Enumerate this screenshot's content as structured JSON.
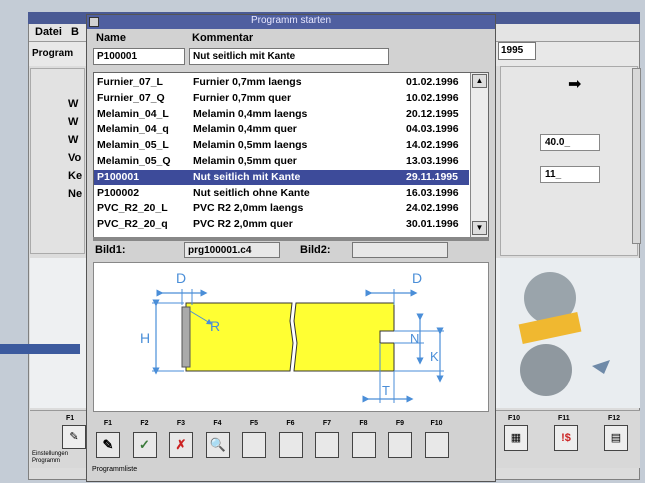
{
  "main": {
    "menu": [
      "Datei",
      "B"
    ],
    "program_label": "Program",
    "date_value": "1995",
    "left_buttons": [
      "W",
      "W",
      "W",
      "Vo",
      "Ke",
      "Ne"
    ],
    "right_inputs": [
      "40.0_",
      "11_"
    ],
    "f_labels": {
      "f1": "F1",
      "f10": "F10",
      "f11": "F11",
      "f12": "F12"
    },
    "bottom_left": "Einstellungen Programm"
  },
  "dialog": {
    "title": "Programm starten",
    "col_name": "Name",
    "col_comment": "Kommentar",
    "name_value": "P100001",
    "comment_value": "Nut seitlich mit Kante",
    "rows": [
      {
        "name": "Furnier_07_L",
        "comment": "Furnier 0,7mm laengs",
        "date": "01.02.1996"
      },
      {
        "name": "Furnier_07_Q",
        "comment": "Furnier 0,7mm quer",
        "date": "10.02.1996"
      },
      {
        "name": "Melamin_04_L",
        "comment": "Melamin 0,4mm laengs",
        "date": "20.12.1995"
      },
      {
        "name": "Melamin_04_q",
        "comment": "Melamin 0,4mm quer",
        "date": "04.03.1996"
      },
      {
        "name": "Melamin_05_L",
        "comment": "Melamin 0,5mm laengs",
        "date": "14.02.1996"
      },
      {
        "name": "Melamin_05_Q",
        "comment": "Melamin 0,5mm quer",
        "date": "13.03.1996"
      },
      {
        "name": "P100001",
        "comment": "Nut seitlich mit Kante",
        "date": "29.11.1995",
        "selected": true
      },
      {
        "name": "P100002",
        "comment": "Nut seitlich ohne Kante",
        "date": "16.03.1996"
      },
      {
        "name": "PVC_R2_20_L",
        "comment": "PVC R2 2,0mm laengs",
        "date": "24.02.1996"
      },
      {
        "name": "PVC_R2_20_q",
        "comment": "PVC R2 2,0mm quer",
        "date": "30.01.1996"
      }
    ],
    "bild1_label": "Bild1:",
    "bild1_value": "prg100001.c4",
    "bild2_label": "Bild2:",
    "bild2_value": "",
    "drawing_labels": {
      "d_left": "D",
      "d_right": "D",
      "h": "H",
      "r": "R",
      "n": "N",
      "k": "K",
      "t": "T"
    },
    "fkeys": [
      {
        "label": "F1",
        "icon": "eraser-icon",
        "glyph": "✎"
      },
      {
        "label": "F2",
        "icon": "checkmark-icon",
        "glyph": "✓"
      },
      {
        "label": "F3",
        "icon": "cross-icon",
        "glyph": "✗"
      },
      {
        "label": "F4",
        "icon": "magnifier-icon",
        "glyph": "🔍"
      },
      {
        "label": "F5",
        "icon": "",
        "glyph": ""
      },
      {
        "label": "F6",
        "icon": "",
        "glyph": ""
      },
      {
        "label": "F7",
        "icon": "",
        "glyph": ""
      },
      {
        "label": "F8",
        "icon": "",
        "glyph": ""
      },
      {
        "label": "F9",
        "icon": "",
        "glyph": ""
      },
      {
        "label": "F10",
        "icon": "",
        "glyph": ""
      }
    ],
    "status": "Programmliste"
  },
  "colors": {
    "title_bar": "#4f5fa0",
    "selection": "#3d4b9a",
    "workpiece": "#ffff33",
    "dimension": "#4a8ed8"
  }
}
